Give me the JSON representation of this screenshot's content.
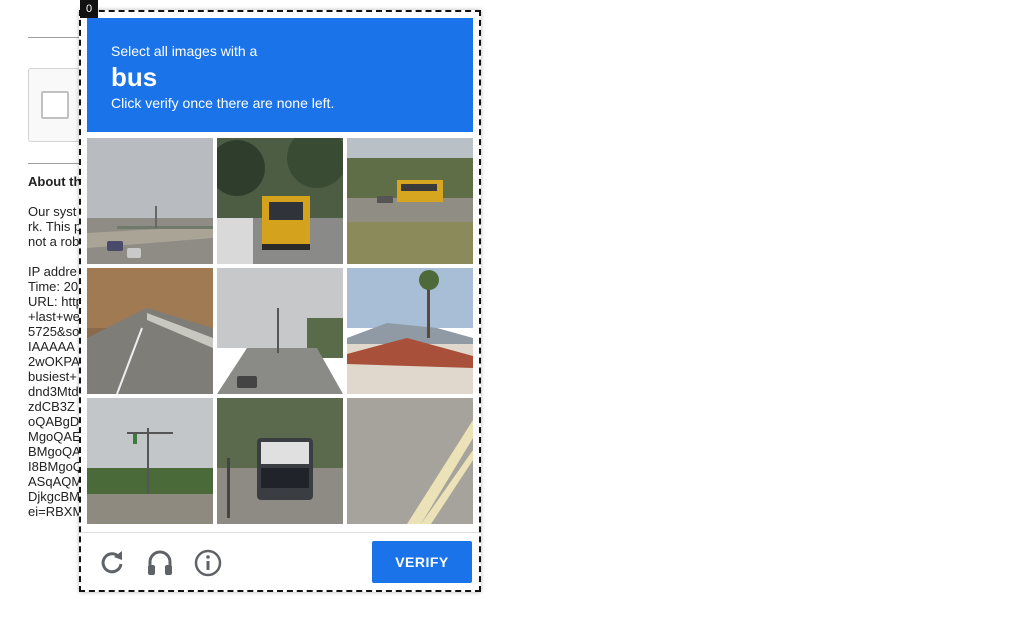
{
  "background_page": {
    "about_heading": "About th",
    "about_lines": [
      "Our syst",
      "rk. This p",
      "not a rob"
    ],
    "info_lines": [
      "IP addre",
      "Time: 20",
      "URL: http",
      "+last+we",
      "5725&so",
      "IAAAAA",
      "2wOKPA",
      "busiest+",
      "dnd3Mtd",
      "zdCB3Z",
      "oQABgD",
      "MgoQAE",
      "BMgoQA",
      "I8BMgoQ",
      "ASqAQM",
      "DjkgcBM",
      "ei=RBXM"
    ]
  },
  "corner_badge": "0",
  "challenge": {
    "instruction": "Select all images with a",
    "target_word": "bus",
    "subtext": "Click verify once there are none left.",
    "tiles": [
      {
        "label": "highway-with-cars"
      },
      {
        "label": "school-bus-rear"
      },
      {
        "label": "school-bus-side"
      },
      {
        "label": "roadside-guardrail"
      },
      {
        "label": "street-intersection"
      },
      {
        "label": "tile-roof-building"
      },
      {
        "label": "traffic-light-road"
      },
      {
        "label": "city-bus-front"
      },
      {
        "label": "road-markings"
      }
    ],
    "verify_label": "VERIFY",
    "icons": [
      "reload-icon",
      "audio-headphones-icon",
      "info-icon"
    ]
  },
  "colors": {
    "accent": "#1a73e8",
    "text_on_accent": "#ffffff"
  }
}
